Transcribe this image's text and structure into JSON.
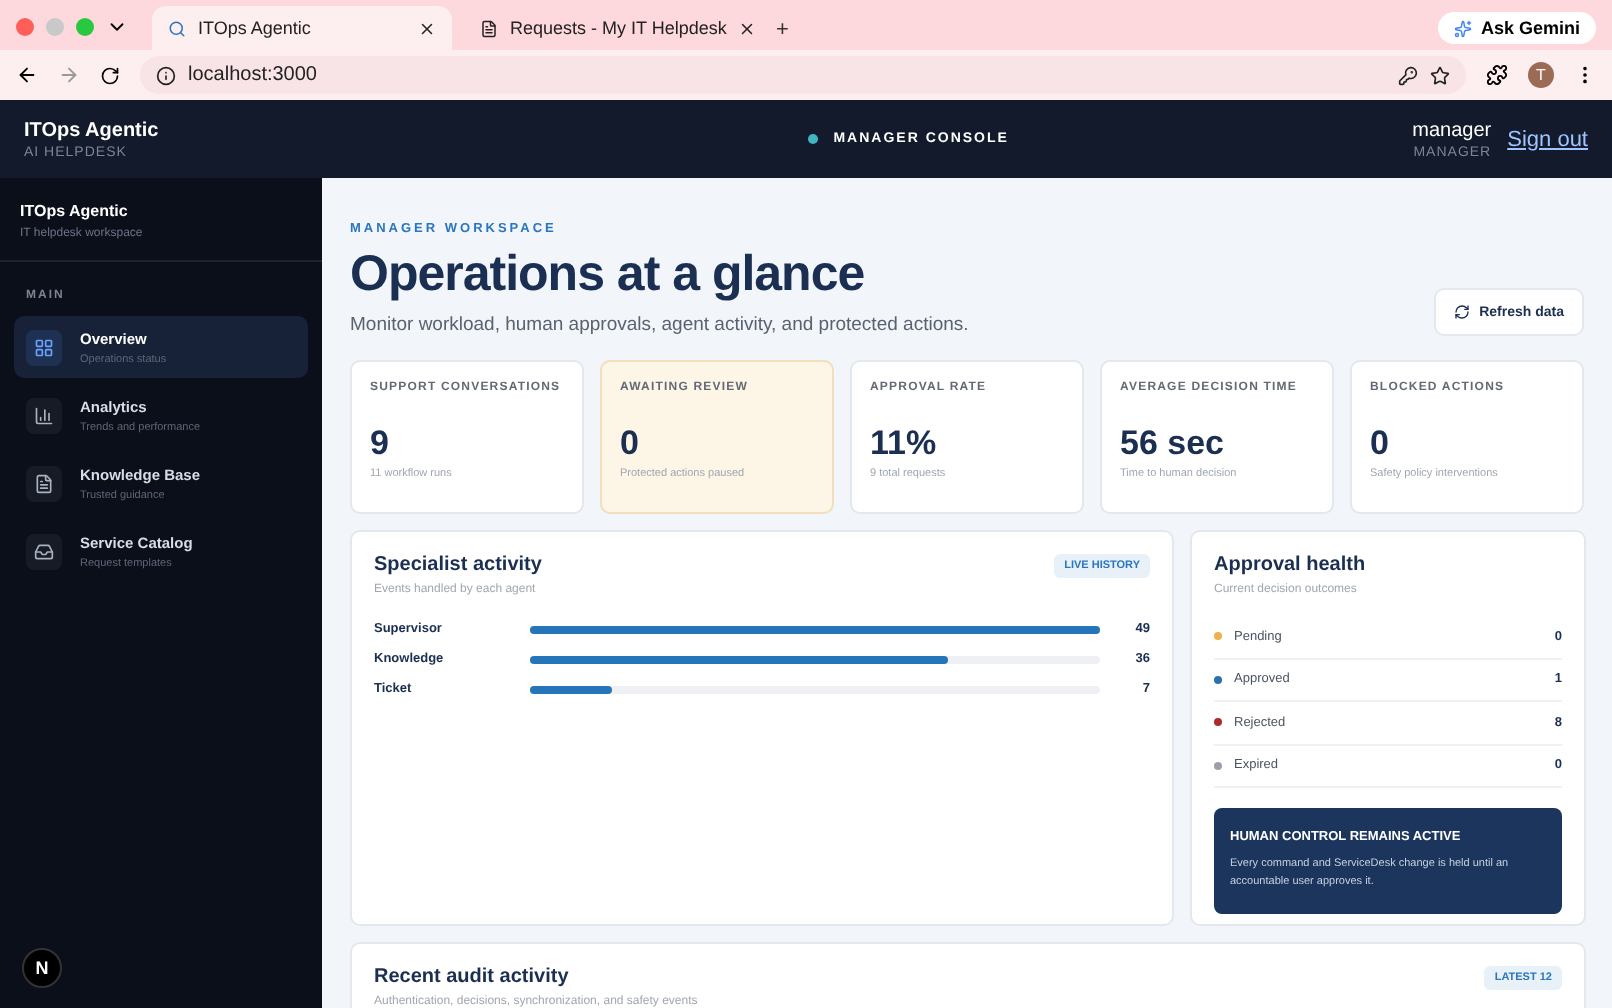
{
  "browser": {
    "tabs": [
      {
        "title": "ITOps Agentic",
        "selected": true
      },
      {
        "title": "Requests - My IT Helpdesk",
        "selected": false
      }
    ],
    "new_tab": "+",
    "gemini": "Ask Gemini",
    "address": "localhost:3000",
    "profile": "T"
  },
  "header": {
    "brand": "ITOps Agentic",
    "brand_sub": "AI HELPDESK",
    "console": "MANAGER CONSOLE",
    "user": "manager",
    "role": "MANAGER",
    "sign_out": "Sign out"
  },
  "sidebar": {
    "title": "ITOps Agentic",
    "subtitle": "IT helpdesk workspace",
    "section": "MAIN",
    "items": [
      {
        "kind": "grid",
        "label": "Overview",
        "sub": "Operations status",
        "selected": true
      },
      {
        "kind": "chart",
        "label": "Analytics",
        "sub": "Trends and performance",
        "selected": false
      },
      {
        "kind": "doc",
        "label": "Knowledge Base",
        "sub": "Trusted guidance",
        "selected": false
      },
      {
        "kind": "inbox",
        "label": "Service Catalog",
        "sub": "Request templates",
        "selected": false
      }
    ],
    "dev_indicator": "N"
  },
  "page": {
    "eyebrow": "MANAGER WORKSPACE",
    "title": "Operations at a glance",
    "subtitle": "Monitor workload, human approvals, agent activity, and protected actions.",
    "refresh": "Refresh data"
  },
  "stats": [
    {
      "label": "SUPPORT CONVERSATIONS",
      "value": "9",
      "note": "11 workflow runs",
      "highlight": false
    },
    {
      "label": "AWAITING REVIEW",
      "value": "0",
      "note": "Protected actions paused",
      "highlight": true
    },
    {
      "label": "APPROVAL RATE",
      "value": "11%",
      "note": "9 total requests",
      "highlight": false
    },
    {
      "label": "AVERAGE DECISION TIME",
      "value": "56 sec",
      "note": "Time to human decision",
      "highlight": false
    },
    {
      "label": "BLOCKED ACTIONS",
      "value": "0",
      "note": "Safety policy interventions",
      "highlight": false
    }
  ],
  "specialist": {
    "title": "Specialist activity",
    "subtitle": "Events handled by each agent",
    "badge": "LIVE HISTORY",
    "agents": [
      {
        "name": "Supervisor",
        "level": 1,
        "count": "49"
      },
      {
        "name": "Knowledge",
        "level": 0.735,
        "count": "36"
      },
      {
        "name": "Ticket",
        "level": 0.143,
        "count": "7"
      }
    ]
  },
  "approval": {
    "title": "Approval health",
    "subtitle": "Current decision outcomes",
    "outcomes": [
      {
        "label": "Pending",
        "count": "0",
        "color": "#f0b04a"
      },
      {
        "label": "Approved",
        "count": "1",
        "color": "#2a6fb0"
      },
      {
        "label": "Rejected",
        "count": "8",
        "color": "#b02a2a"
      },
      {
        "label": "Expired",
        "count": "0",
        "color": "#9aa0a6"
      }
    ],
    "notice_title": "HUMAN CONTROL REMAINS ACTIVE",
    "notice_text": "Every command and ServiceDesk change is held until an accountable user approves it."
  },
  "audit": {
    "title": "Recent audit activity",
    "subtitle": "Authentication, decisions, synchronization, and safety events",
    "badge": "LATEST 12"
  }
}
